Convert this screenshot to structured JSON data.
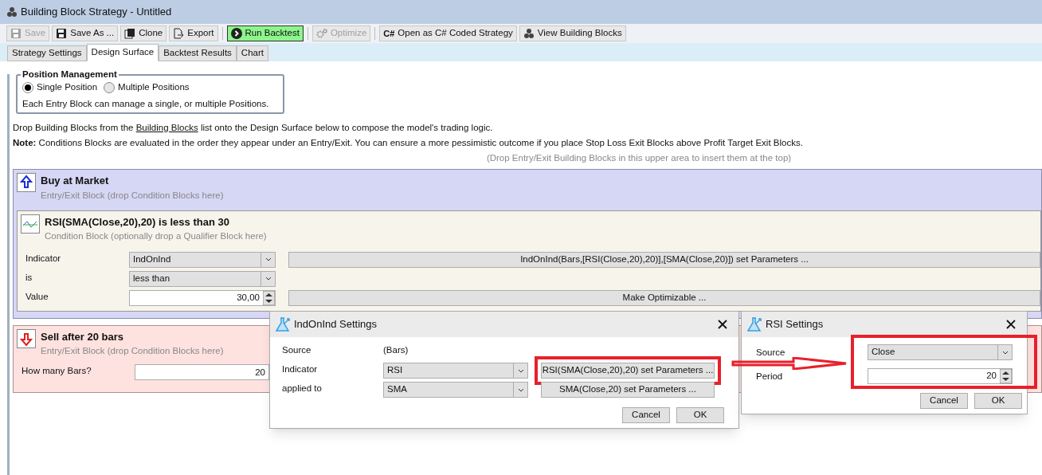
{
  "window": {
    "title": "Building Block Strategy - Untitled"
  },
  "toolbar": [
    {
      "label": "Save",
      "kind": "save",
      "disabled": true
    },
    {
      "label": "Save As ...",
      "kind": "save",
      "disabled": false
    },
    {
      "label": "Clone",
      "kind": "clone",
      "disabled": false
    },
    {
      "label": "Export",
      "kind": "export",
      "disabled": false
    },
    {
      "label": "Run Backtest",
      "kind": "run",
      "disabled": false
    },
    {
      "label": "Optimize",
      "kind": "gear",
      "disabled": true
    },
    {
      "label": "Open as C# Coded Strategy",
      "kind": "csharp",
      "icon_text": "C#",
      "disabled": false
    },
    {
      "label": "View Building Blocks",
      "kind": "blocks",
      "disabled": false
    }
  ],
  "tabs": [
    {
      "label": "Strategy Settings",
      "selected": false
    },
    {
      "label": "Design Surface",
      "selected": true
    },
    {
      "label": "Backtest Results",
      "selected": false
    },
    {
      "label": "Chart",
      "selected": false
    }
  ],
  "position_management": {
    "title": "Position Management",
    "options": [
      {
        "label": "Single Position",
        "selected": true
      },
      {
        "label": "Multiple Positions",
        "selected": false
      }
    ],
    "note": "Each Entry Block can manage a single, or multiple Positions."
  },
  "instructions": {
    "before_link": "Drop Building Blocks from the",
    "link": "Building Blocks",
    "after_link": "list onto the Design Surface below to compose the model's trading logic.",
    "note": "**Note:** Conditions Blocks are evaluated in the order they appear under an Entry/Exit. You can ensure a more pessimistic outcome if you place Stop Loss Exit Blocks above Profit Target Exit Blocks.",
    "drop_hint": "(Drop Entry/Exit Building Blocks in this upper area to insert them at the top)"
  },
  "entry_block": {
    "title": "Buy at Market",
    "subtitle": "Entry/Exit Block (drop Condition Blocks here)",
    "condition": {
      "title": "RSI(SMA(Close,20),20) is less than 30",
      "subtitle": "Condition Block (optionally drop a Qualifier Block here)",
      "rows": [
        {
          "label": "Indicator",
          "kind": "dropdown",
          "value": "IndOnInd",
          "button": "IndOnInd(Bars,[RSI(Close,20),20)],[SMA(Close,20)]) set Parameters ..."
        },
        {
          "label": "is",
          "kind": "dropdown",
          "value": "less than"
        },
        {
          "label": "Value",
          "kind": "spinner",
          "value": "30,00",
          "button": "Make Optimizable ..."
        }
      ]
    }
  },
  "exit_block": {
    "title": "Sell after 20 bars",
    "subtitle": "Entry/Exit Block (drop Condition Blocks here)",
    "rows": [
      {
        "label": "How many Bars?",
        "kind": "spinner",
        "value": "20"
      }
    ]
  },
  "indonind_dialog": {
    "title": "IndOnInd Settings",
    "rows": [
      {
        "label": "Source",
        "kind": "text",
        "value": "(Bars)"
      },
      {
        "label": "Indicator",
        "kind": "dropdown",
        "value": "RSI",
        "button": "RSI(SMA(Close,20),20) set Parameters ...",
        "highlighted": true
      },
      {
        "label": "applied to",
        "kind": "dropdown",
        "value": "SMA",
        "button": "SMA(Close,20) set Parameters ...",
        "highlighted": false
      }
    ],
    "buttons": [
      "Cancel",
      "OK"
    ]
  },
  "rsi_dialog": {
    "title": "RSI Settings",
    "rows": [
      {
        "label": "Source",
        "kind": "dropdown",
        "value": "Close"
      },
      {
        "label": "Period",
        "kind": "spinner",
        "value": "20"
      }
    ],
    "buttons": [
      "Cancel",
      "OK"
    ]
  }
}
